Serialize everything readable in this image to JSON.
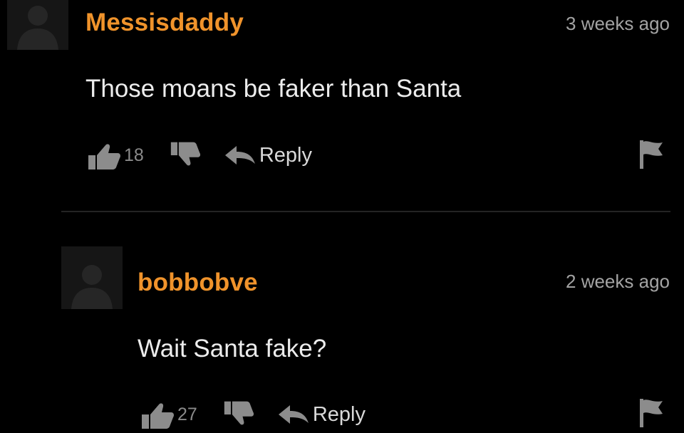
{
  "comments": [
    {
      "username": "Messisdaddy",
      "timestamp": "3 weeks ago",
      "text": "Those moans be faker than Santa",
      "likes": "18",
      "reply_label": "Reply"
    },
    {
      "username": "bobbobve",
      "timestamp": "2 weeks ago",
      "text": "Wait Santa fake?",
      "likes": "27",
      "reply_label": "Reply"
    }
  ],
  "icons": {
    "avatar": "user-silhouette-icon",
    "like": "thumbs-up-icon",
    "dislike": "thumbs-down-icon",
    "reply": "reply-arrow-icon",
    "flag": "flag-icon"
  },
  "colors": {
    "background": "#000000",
    "username": "#f0932b",
    "text": "#ececec",
    "muted": "#a3a3a3",
    "icon": "#8c8c8c"
  }
}
